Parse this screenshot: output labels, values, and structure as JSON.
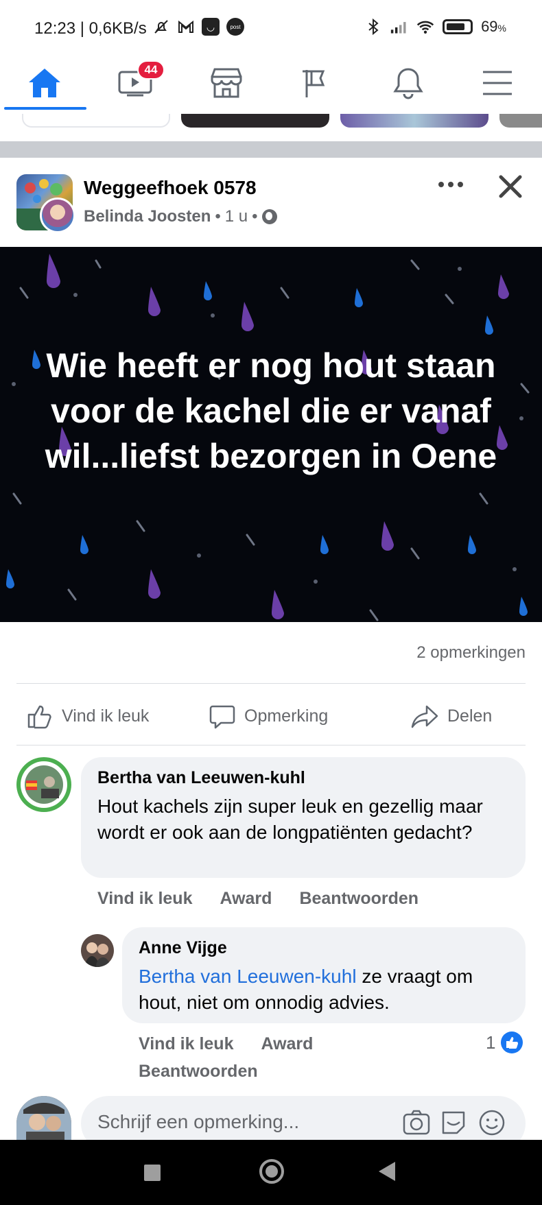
{
  "status_bar": {
    "time": "12:23",
    "network_speed": "0,6KB/s",
    "battery_percent": "69",
    "battery_unit": "%",
    "icons": [
      "silent-icon",
      "gmail-icon",
      "shop-icon",
      "postnl-icon",
      "bluetooth-icon",
      "signal-icon",
      "wifi-icon",
      "battery-icon"
    ]
  },
  "nav": {
    "items": [
      "home",
      "video",
      "marketplace",
      "pages",
      "notifications",
      "menu"
    ],
    "video_badge": "44",
    "accent": "#1877f2"
  },
  "post": {
    "group_name": "Weggeefhoek 0578",
    "author": "Belinda Joosten",
    "separator": "•",
    "time": "1 u",
    "text": "Wie heeft er nog hout staan voor de kachel die er vanaf wil...liefst bezorgen in Oene",
    "comment_count": "2 opmerkingen",
    "actions": {
      "like": "Vind ik leuk",
      "comment": "Opmerking",
      "share": "Delen"
    }
  },
  "comments": [
    {
      "author": "Bertha van Leeuwen-kuhl",
      "text": "Hout kachels zijn super leuk en gezellig maar wordt er ook aan de longpatiënten gedacht?",
      "actions": [
        "Vind ik leuk",
        "Award",
        "Beantwoorden"
      ]
    },
    {
      "author": "Anne Vijge",
      "mention": "Bertha van Leeuwen-kuhl",
      "text": " ze vraagt om hout, niet om onnodig advies.",
      "actions": [
        "Vind ik leuk",
        "Award",
        "Beantwoorden"
      ],
      "likes": "1"
    }
  ],
  "composer": {
    "placeholder": "Schrijf een opmerking..."
  }
}
